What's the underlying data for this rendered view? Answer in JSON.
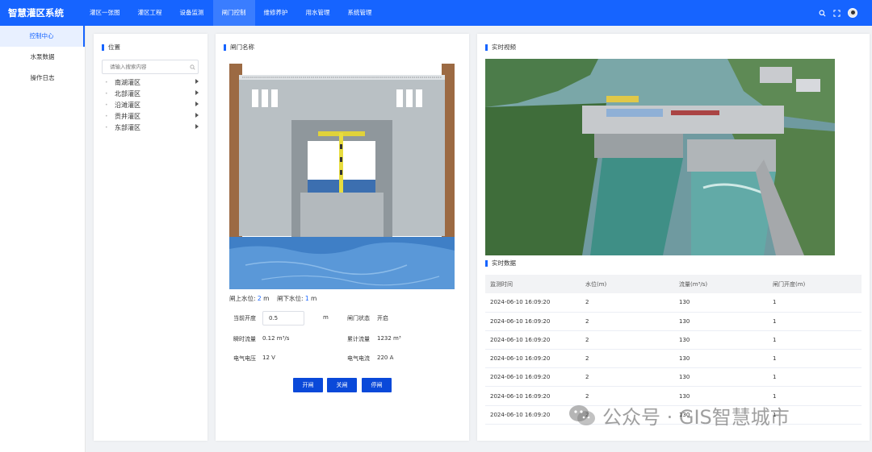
{
  "app": {
    "title": "智慧灌区系统"
  },
  "nav": {
    "items": [
      {
        "label": "灌区一张图"
      },
      {
        "label": "灌区工程"
      },
      {
        "label": "设备监测"
      },
      {
        "label": "闸门控制"
      },
      {
        "label": "维修养护"
      },
      {
        "label": "用水管理"
      },
      {
        "label": "系统管理"
      }
    ],
    "active_index": 3
  },
  "header_icons": [
    "search-icon",
    "fullscreen-icon",
    "user-avatar"
  ],
  "sidebar": {
    "items": [
      {
        "label": "控制中心"
      },
      {
        "label": "水泵数据"
      },
      {
        "label": "操作日志"
      }
    ],
    "active_index": 0
  },
  "location_panel": {
    "title": "位置",
    "search_placeholder": "请输入搜索内容",
    "tree": [
      {
        "label": "南湖灌区"
      },
      {
        "label": "北部灌区"
      },
      {
        "label": "沿滩灌区"
      },
      {
        "label": "贡井灌区"
      },
      {
        "label": "东部灌区"
      }
    ]
  },
  "gate_panel": {
    "title": "闸门名称",
    "upstream_label": "闸上水位:",
    "upstream_value": "2",
    "downstream_label": "闸下水位:",
    "downstream_value": "1",
    "level_unit": "m",
    "opening_label": "当前开度",
    "opening_value": "0.5",
    "opening_unit": "m",
    "status_label": "闸门状态",
    "status_value": "开启",
    "flow_label": "瞬时流量",
    "flow_value": "0.12 m³/s",
    "total_label": "累计流量",
    "total_value": "1232 m³",
    "voltage_label": "电气电压",
    "voltage_value": "12 V",
    "current_label": "电气电流",
    "current_value": "220 A",
    "buttons": {
      "open": "开闸",
      "close": "关闸",
      "stop": "停闸"
    }
  },
  "video_panel": {
    "title": "实时视频"
  },
  "data_panel": {
    "title": "实时数据",
    "columns": [
      "监测时间",
      "水位(m)",
      "流量(m³/s)",
      "闸门开度(m)"
    ],
    "rows": [
      [
        "2024-06-10 16:09:20",
        "2",
        "130",
        "1"
      ],
      [
        "2024-06-10 16:09:20",
        "2",
        "130",
        "1"
      ],
      [
        "2024-06-10 16:09:20",
        "2",
        "130",
        "1"
      ],
      [
        "2024-06-10 16:09:20",
        "2",
        "130",
        "1"
      ],
      [
        "2024-06-10 16:09:20",
        "2",
        "130",
        "1"
      ],
      [
        "2024-06-10 16:09:20",
        "2",
        "130",
        "1"
      ],
      [
        "2024-06-10 16:09:20",
        "2",
        "130",
        "1"
      ]
    ]
  },
  "watermark": {
    "text": "公众号 · GIS智慧城市"
  },
  "colors": {
    "primary": "#1664ff",
    "button": "#0a49d9",
    "background": "#f0f2f5"
  }
}
